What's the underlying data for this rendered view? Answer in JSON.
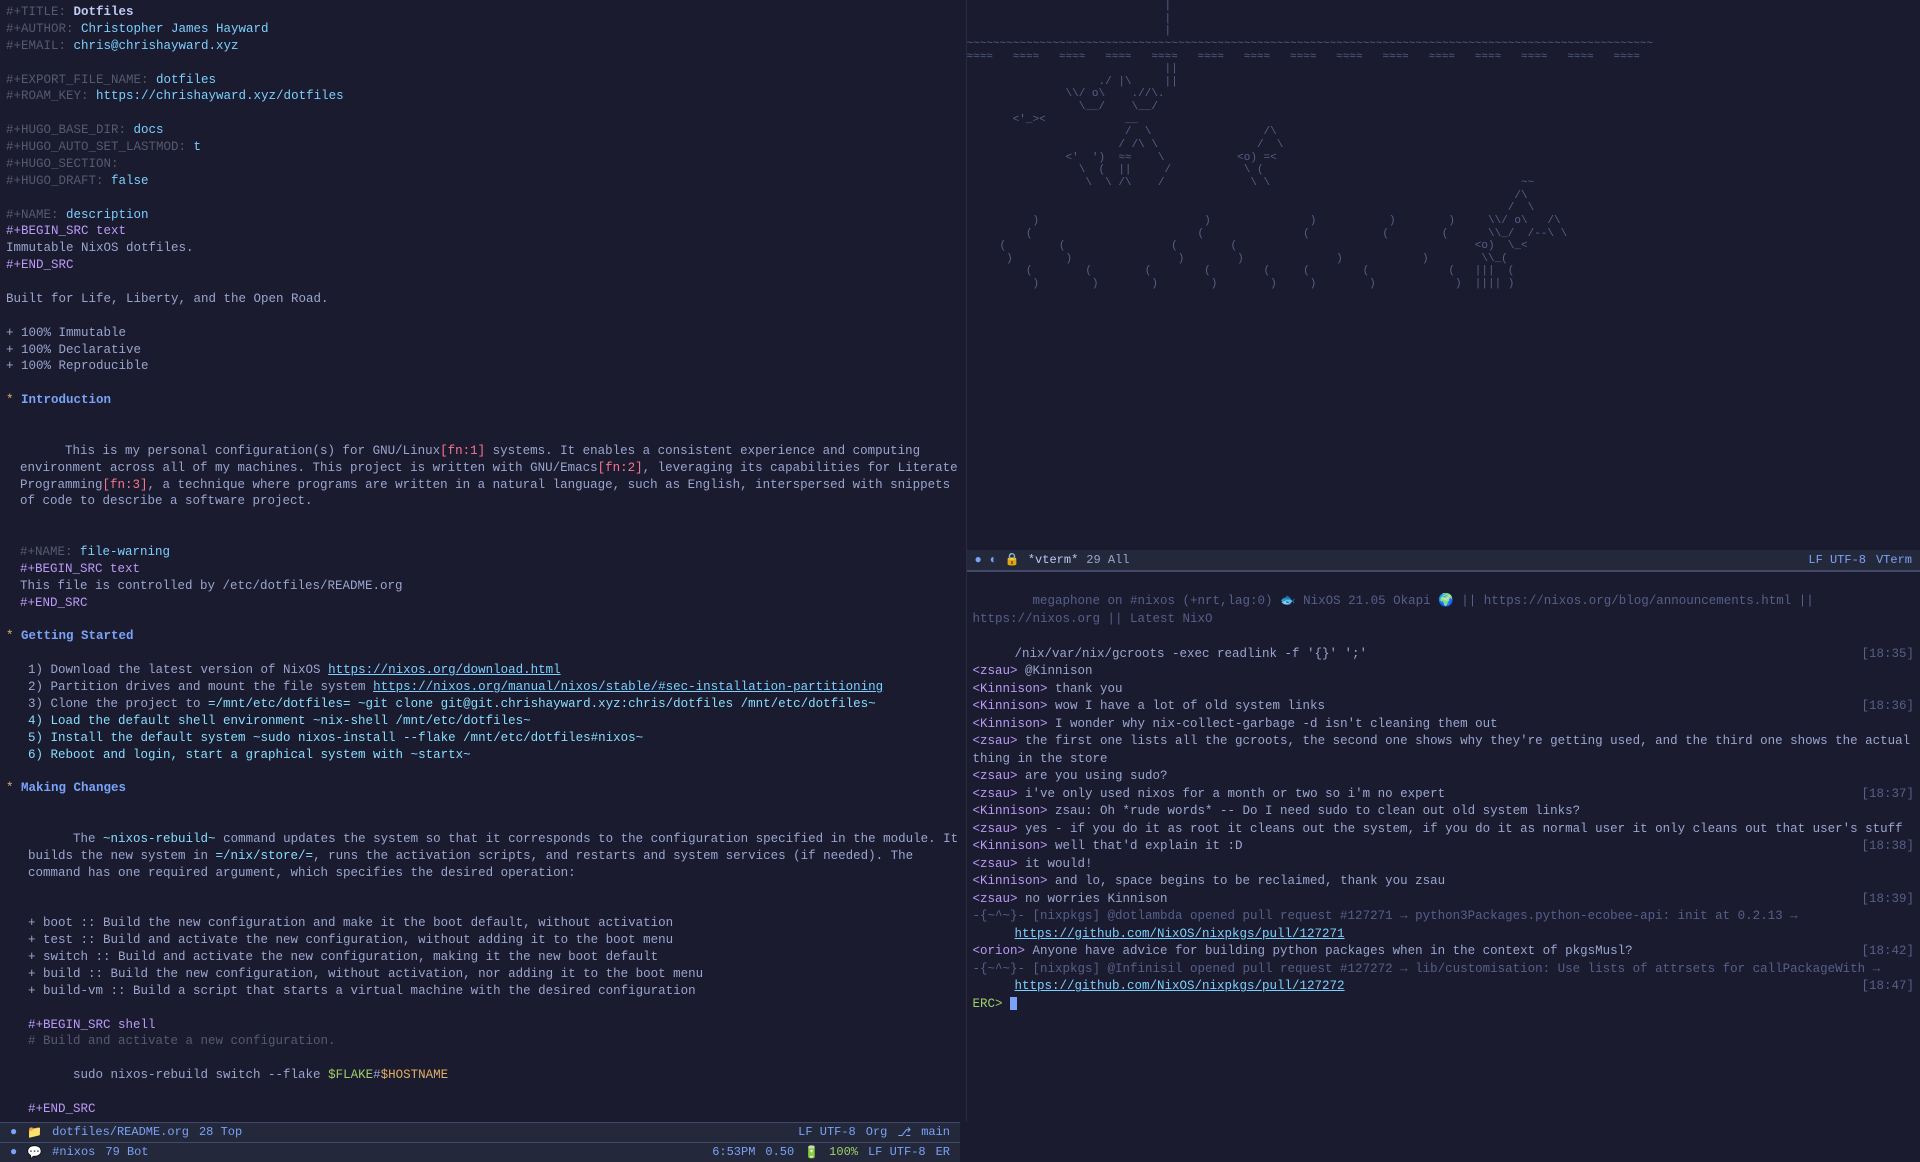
{
  "left_doc": {
    "title_key": "#+TITLE:",
    "title_val": "Dotfiles",
    "author_key": "#+AUTHOR:",
    "author_val": "Christopher James Hayward",
    "email_key": "#+EMAIL:",
    "email_val": "chris@chrishayward.xyz",
    "export_key": "#+EXPORT_FILE_NAME:",
    "export_val": "dotfiles",
    "roam_key": "#+ROAM_KEY:",
    "roam_val": "https://chrishayward.xyz/dotfiles",
    "hugo_base_key": "#+HUGO_BASE_DIR:",
    "hugo_base_val": "docs",
    "hugo_lastmod_key": "#+HUGO_AUTO_SET_LASTMOD:",
    "hugo_lastmod_val": "t",
    "hugo_section_key": "#+HUGO_SECTION:",
    "hugo_section_val": "",
    "hugo_draft_key": "#+HUGO_DRAFT:",
    "hugo_draft_val": "false",
    "name1_key": "#+NAME:",
    "name1_val": "description",
    "begin_text": "#+BEGIN_SRC text",
    "desc_body": "Immutable NixOS dotfiles.",
    "end_src": "#+END_SRC",
    "tagline": "Built for Life, Liberty, and the Open Road.",
    "bullets": [
      "+ 100% Immutable",
      "+ 100% Declarative",
      "+ 100% Reproducible"
    ],
    "h1": "Introduction",
    "intro_p1a": "This is my personal configuration(s) for GNU/Linux",
    "fn1": "[fn:1]",
    "intro_p1b": " systems. It enables a consistent experience and computing environment across all of my machines. This project is written with GNU/Emacs",
    "fn2": "[fn:2]",
    "intro_p1c": ", leveraging its capabilities for Literate Programming",
    "fn3": "[fn:3]",
    "intro_p1d": ", a technique where programs are written in a natural language, such as English, interspersed with snippets of code to describe a software project.",
    "name2_key": "#+NAME:",
    "name2_val": "file-warning",
    "warn_body": "This file is controlled by /etc/dotfiles/README.org",
    "h2": "Getting Started",
    "gs_1a": "1) Download the latest version of NixOS ",
    "gs_1b": "https://nixos.org/download.html",
    "gs_2a": "2) Partition drives and mount the file system ",
    "gs_2b": "https://nixos.org/manual/nixos/stable/#sec-installation-partitioning",
    "gs_3a": "3) Clone the project to ",
    "gs_3b": "=/mnt/etc/dotfiles= ~git clone git@git.chrishayward.xyz:chris/dotfiles /mnt/etc/dotfiles~",
    "gs_4": "4) Load the default shell environment ~nix-shell /mnt/etc/dotfiles~",
    "gs_5": "5) Install the default system ~sudo nixos-install --flake /mnt/etc/dotfiles#nixos~",
    "gs_6": "6) Reboot and login, start a graphical system with ~startx~",
    "h3": "Making Changes",
    "mc_p1a": "The ",
    "mc_p1b": "~nixos-rebuild~",
    "mc_p1c": " command updates the system so that it corresponds to the configuration specified in the module. It builds the new system in ",
    "mc_p1d": "=/nix/store/=",
    "mc_p1e": ", runs the activation scripts, and restarts and system services (if needed). The command has one required argument, which specifies the desired operation:",
    "mc_b1": "+ boot :: Build the new configuration and make it the boot default, without activation",
    "mc_b2": "+ test :: Build and activate the new configuration, without adding it to the boot menu",
    "mc_b3": "+ switch :: Build and activate the new configuration, making it the new boot default",
    "mc_b4": "+ build :: Build the new configuration, without activation, nor adding it to the boot menu",
    "mc_b5": "+ build-vm :: Build a script that starts a virtual machine with the desired configuration",
    "begin_shell": "#+BEGIN_SRC shell",
    "shell_comment": "# Build and activate a new configuration.",
    "shell_cmd1": "sudo nixos-rebuild switch --flake ",
    "shell_flake": "$FLAKE",
    "shell_sep": "#",
    "shell_host": "$HOSTNAME"
  },
  "left_modeline": {
    "file": "dotfiles/README.org",
    "pos": "28 Top",
    "enc": "LF UTF-8",
    "mode": "Org",
    "branch": "main"
  },
  "vterm_modeline": {
    "title": "*vterm*",
    "pos": "29 All",
    "enc": "LF UTF-8",
    "mode": "VTerm"
  },
  "irc": {
    "topic1a": "megaphone on #nixos (+nrt,lag:0) ",
    "topic1b": " NixOS 21.05 Okapi ",
    "topic1c": " || https://nixos.org/blog/announcements.html || https://nixos.org || Latest NixO",
    "topic2": "/nix/var/nix/gcroots -exec readlink -f '{}' ';'",
    "ts_topic": "[18:35]",
    "lines": [
      {
        "nick": "<zsau>",
        "text": " @Kinnison",
        "ts": ""
      },
      {
        "nick": "<Kinnison>",
        "text": " thank you",
        "ts": ""
      },
      {
        "nick": "<Kinnison>",
        "text": " wow I have a lot of old system links",
        "ts": "[18:36]"
      },
      {
        "nick": "<Kinnison>",
        "text": " I wonder why nix-collect-garbage -d isn't cleaning them out",
        "ts": ""
      },
      {
        "nick": "<zsau>",
        "text": " the first one lists all the gcroots, the second one shows why they're getting used, and the third one shows the actual thing in the store",
        "ts": ""
      },
      {
        "nick": "<zsau>",
        "text": " are you using sudo?",
        "ts": ""
      },
      {
        "nick": "<zsau>",
        "text": " i've only used nixos for a month or two so i'm no expert",
        "ts": "[18:37]"
      },
      {
        "nick": "<Kinnison>",
        "text": " zsau: Oh *rude words* -- Do I need sudo to clean out old system links?",
        "ts": ""
      },
      {
        "nick": "<zsau>",
        "text": " yes - if you do it as root it cleans out the system, if you do it as normal user it only cleans out that user's stuff",
        "ts": ""
      },
      {
        "nick": "<Kinnison>",
        "text": " well that'd explain it :D",
        "ts": "[18:38]"
      },
      {
        "nick": "<zsau>",
        "text": " it would!",
        "ts": ""
      },
      {
        "nick": "<Kinnison>",
        "text": " and lo, space begins to be reclaimed, thank you zsau",
        "ts": ""
      },
      {
        "nick": "<zsau>",
        "text": " no worries Kinnison",
        "ts": "[18:39]"
      }
    ],
    "sys1a": "-{~^~}- [nixpkgs] @dotlambda opened pull request #127271 → python3Packages.python-ecobee-api: init at 0.2.13 → ",
    "sys1b": "https://github.com/NixOS/nixpkgs/pull/127271",
    "orion_nick": "<orion>",
    "orion_text": " Anyone have advice for building python packages when in the context of pkgsMusl?",
    "orion_ts": "[18:42]",
    "sys2a": "-{~^~}- [nixpkgs] @Infinisil opened pull request #127272 → lib/customisation: Use lists of attrsets for callPackageWith → ",
    "sys2b": "https://github.com/NixOS/nixpkgs/pull/127272",
    "sys2_ts": "[18:47]",
    "prompt": "ERC> "
  },
  "irc_modeline": {
    "channel": "#nixos",
    "pos": "79 Bot",
    "time": "6:53PM",
    "load": "0.50",
    "battery": "100%",
    "enc": "LF UTF-8",
    "mode": "ER"
  },
  "ascii": {
    "art": "                              |\n                              |\n                              |\n~~~~~~~~~~~~~~~~~~~~~~~~~~~~~~~~~~~~~~~~~~~~~~~~~~~~~~~~~~~~~~~~~~~~~~~~~~~~~~~~~~~~~~~~~~~~~~~~~~~~~~~~\n≈≈≈≈   ≈≈≈≈   ≈≈≈≈   ≈≈≈≈   ≈≈≈≈   ≈≈≈≈   ≈≈≈≈   ≈≈≈≈   ≈≈≈≈   ≈≈≈≈   ≈≈≈≈   ≈≈≈≈   ≈≈≈≈   ≈≈≈≈   ≈≈≈≈\n                              ||\n                    ./ |\\     ||\n               \\\\/ o\\    .//\\.\n                 \\__/    \\__/\n       <'_><            __\n                        /  \\                 /\\\n                       / /\\ \\               /  \\\n               <'  ')  ≈≈    \\           <o) =<\n                 \\  (  ||     /           \\ (\n                  \\  \\ /\\    /             \\ \\                                      ~~\n                                                                                   /\\\n                                                                                  /  \\\n          )                         )               )           )        )     \\\\/ o\\   /\\\n         (                         (               (           (        (      \\\\_/  /--\\ \\\n     (        (                (        (                                    <o)  \\_<\n      )        )                )        )              )            )        \\\\_(\n         (        (        (        (        (     (        (            (   |||  (\n          )        )        )        )        )     )        )            )  |||| )"
  }
}
